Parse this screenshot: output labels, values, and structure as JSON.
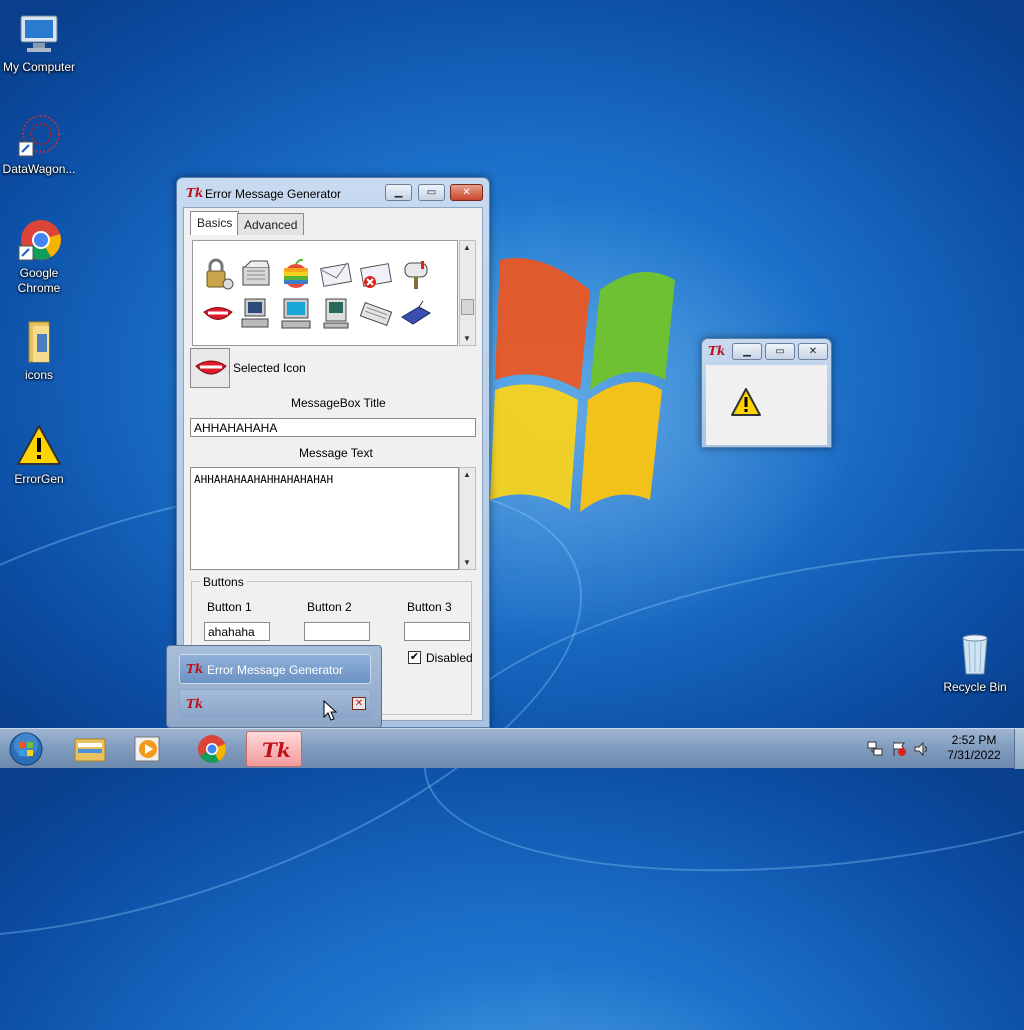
{
  "desktop": {
    "icons": [
      {
        "label": "My Computer",
        "icon": "computer-icon"
      },
      {
        "label": "DataWagon...",
        "icon": "datawagon-icon"
      },
      {
        "label": "Google Chrome",
        "icon": "chrome-icon"
      },
      {
        "label": "icons",
        "icon": "folder-icon"
      },
      {
        "label": "ErrorGen",
        "icon": "warning-icon"
      },
      {
        "label": "Recycle Bin",
        "icon": "recycle-bin-icon"
      }
    ]
  },
  "generator": {
    "title": "Error Message Generator",
    "app_icon": "Tk",
    "tabs": [
      "Basics",
      "Advanced"
    ],
    "selected_icon_label": "Selected Icon",
    "msgbox_title_label": "MessageBox Title",
    "msgbox_title_value": "AHHAHAHAHA",
    "message_text_label": "Message Text",
    "message_text_value": "AHHAHAHAAHAHHAHAHAHAH",
    "buttons_group_label": "Buttons",
    "button_labels": [
      "Button 1",
      "Button 2",
      "Button 3"
    ],
    "button_values": [
      "ahahaha",
      "",
      ""
    ],
    "disabled_label": "Disabled",
    "disabled_checked": true
  },
  "preview": {
    "app_icon": "Tk",
    "icon": "warning-icon"
  },
  "taskbar": {
    "pinned": [
      "start-orb",
      "explorer-icon",
      "media-player-icon",
      "chrome-icon",
      "tk-app-icon"
    ],
    "clock_time": "2:52 PM",
    "clock_date": "7/31/2022",
    "popup": {
      "items": [
        {
          "label": "Error Message Generator",
          "app_icon": "Tk"
        },
        {
          "label": "",
          "app_icon": "Tk"
        }
      ]
    }
  }
}
